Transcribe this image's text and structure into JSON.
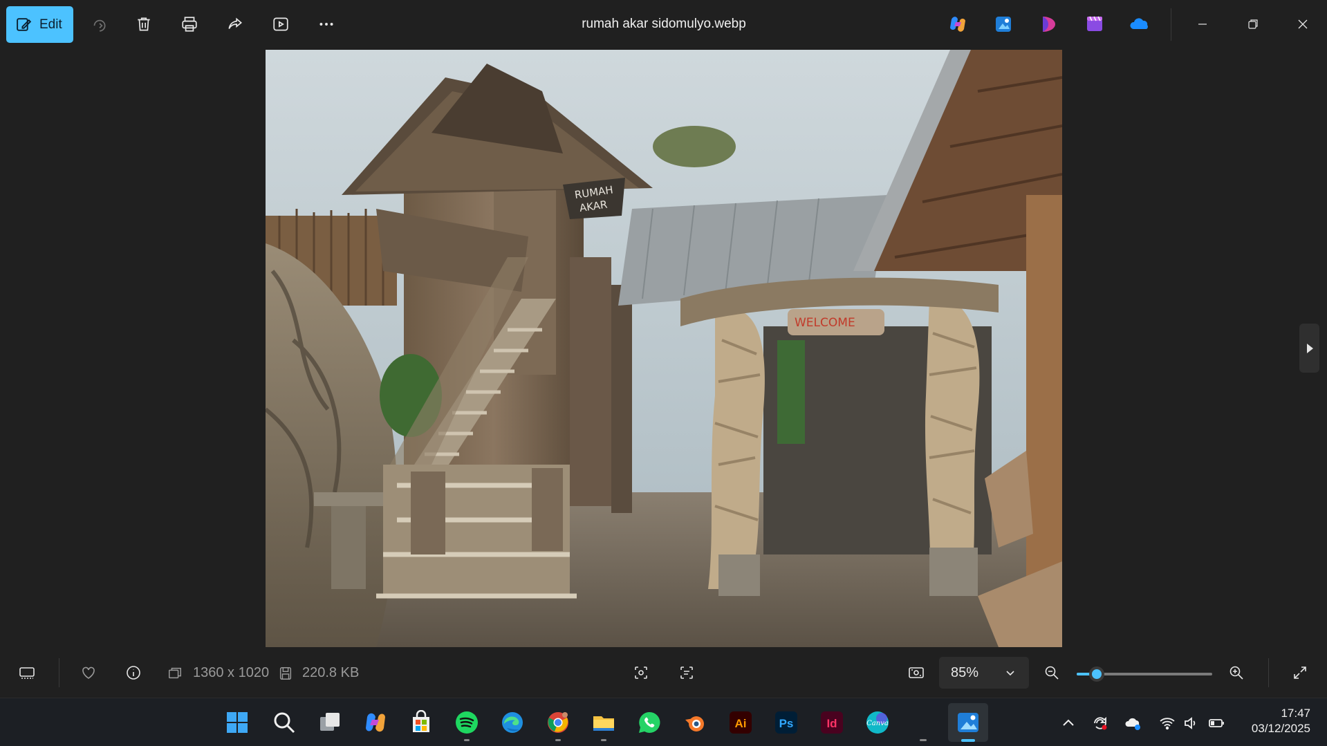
{
  "toolbar": {
    "edit_label": "Edit",
    "icons": [
      "edit-icon",
      "rotate-icon",
      "delete-icon",
      "print-icon",
      "share-icon",
      "slideshow-icon",
      "more-icon"
    ]
  },
  "window": {
    "title": "rumah akar sidomulyo.webp",
    "app_icons": [
      "copilot-icon",
      "photos-editor-icon",
      "clipchamp-pink-icon",
      "clipchamp-icon",
      "onedrive-icon"
    ],
    "controls": [
      "minimize-icon",
      "restore-icon",
      "close-icon"
    ]
  },
  "photo": {
    "sign_top_1": "RUMAH",
    "sign_top_2": "AKAR",
    "sign_welcome": "WELCOME"
  },
  "statusbar": {
    "dimensions": "1360 x 1020",
    "file_size": "220.8 KB",
    "zoom_value": "85%",
    "zoom_fraction": 0.15
  },
  "taskbar": {
    "apps": [
      "windows-start",
      "search",
      "task-view",
      "copilot",
      "microsoft-store",
      "spotify",
      "edge",
      "chrome",
      "file-explorer",
      "whatsapp",
      "blender",
      "illustrator",
      "photoshop",
      "indesign",
      "canva",
      "photos"
    ],
    "illustrator_label": "Ai",
    "photoshop_label": "Ps",
    "indesign_label": "Id",
    "canva_label": "Canva",
    "time": "17:47",
    "date": "03/12/2025"
  },
  "colors": {
    "accent": "#4cc2ff",
    "background": "#202020",
    "taskbar": "#1c1f24"
  }
}
